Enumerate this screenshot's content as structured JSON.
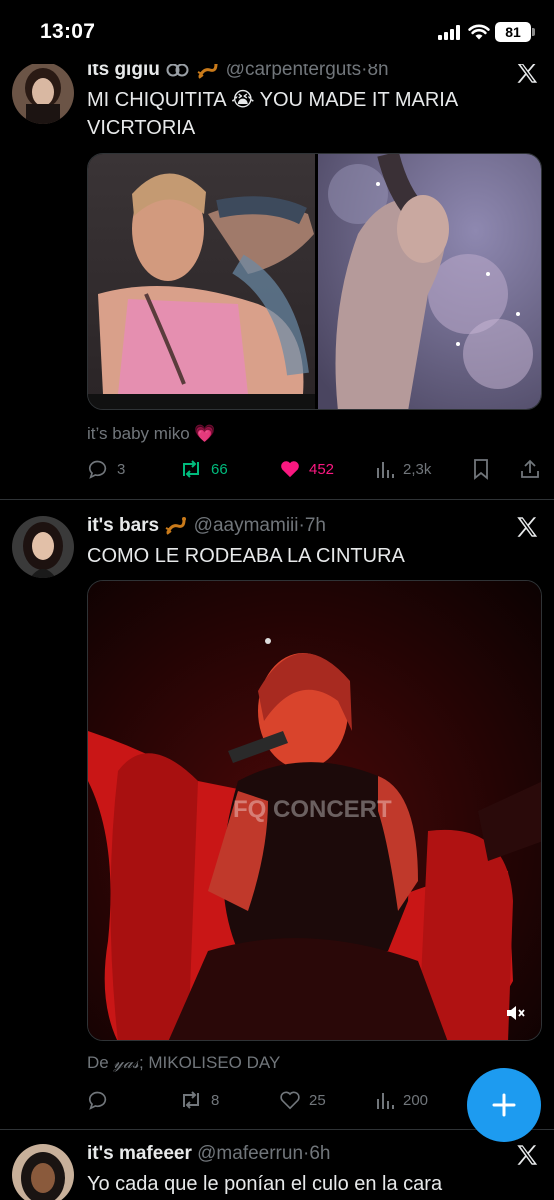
{
  "status_bar": {
    "time": "13:07",
    "battery": "81"
  },
  "tweets": [
    {
      "name": "its gigiu",
      "name_icons": [
        "link-icon",
        "scorpion-emoji"
      ],
      "handle": "@carpenterguts",
      "separator": "·",
      "time": "8h",
      "text": "MI CHIQUITITA 😭 YOU MADE IT MARIA VICRTORIA",
      "text_line1": "MI CHIQUITITA",
      "text_emoji": "😭",
      "text_line1_after": "YOU MADE IT MARIA",
      "text_line2": "VICRTORIA",
      "media": [
        "concert-photo-pink-top",
        "concert-photo-bowing"
      ],
      "caption": "it’s baby miko",
      "caption_emoji": "💗",
      "stats": {
        "replies": "3",
        "reposts": "66",
        "likes": "452",
        "views": "2,3k"
      },
      "colors": {
        "repost": "#00ba7c",
        "like": "#f91880"
      }
    },
    {
      "name": "it's bars",
      "name_icons": [
        "scorpion-emoji"
      ],
      "handle": "@aaymamiii",
      "separator": "·",
      "time": "7h",
      "text": "COMO LE RODEABA LA CINTURA",
      "media": [
        "concert-video-red-chair"
      ],
      "watermark": "FQ CONCERT",
      "caption_prefix": "De",
      "caption_styled": "𝓎𝒶𝓈",
      "caption_rest": "; MIKOLISEO DAY",
      "stats": {
        "replies": "",
        "reposts": "8",
        "likes": "25",
        "views": "200"
      }
    },
    {
      "name": "it's mafeeer",
      "handle": "@mafeerrun",
      "separator": "·",
      "time": "6h",
      "text": "Yo cada que le ponían el culo en la cara"
    }
  ],
  "colors": {
    "background": "#000000",
    "text": "#e7e9ea",
    "muted": "#71767b",
    "accent": "#1d9bf0",
    "divider": "#2f3336"
  }
}
